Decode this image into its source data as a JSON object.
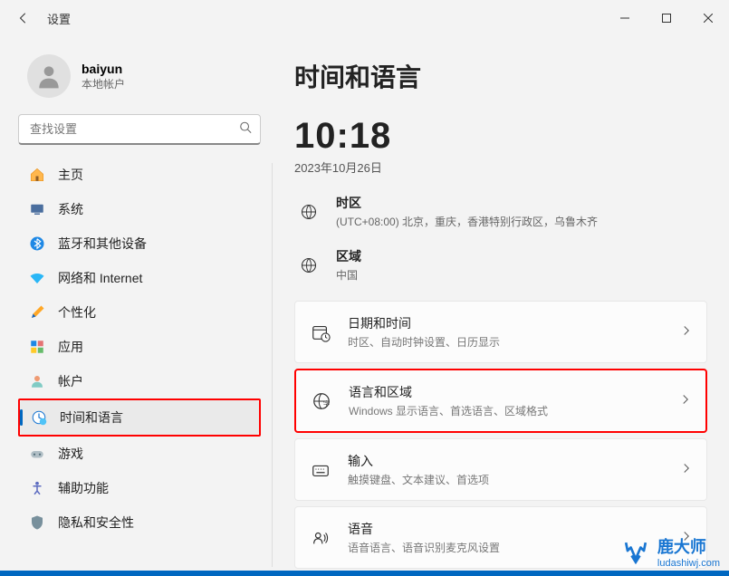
{
  "window": {
    "title": "设置"
  },
  "user": {
    "name": "baiyun",
    "type": "本地帐户"
  },
  "search": {
    "placeholder": "查找设置"
  },
  "nav": {
    "items": [
      {
        "label": "主页"
      },
      {
        "label": "系统"
      },
      {
        "label": "蓝牙和其他设备"
      },
      {
        "label": "网络和 Internet"
      },
      {
        "label": "个性化"
      },
      {
        "label": "应用"
      },
      {
        "label": "帐户"
      },
      {
        "label": "时间和语言"
      },
      {
        "label": "游戏"
      },
      {
        "label": "辅助功能"
      },
      {
        "label": "隐私和安全性"
      }
    ]
  },
  "page": {
    "title": "时间和语言",
    "time": "10:18",
    "date": "2023年10月26日",
    "timezone": {
      "label": "时区",
      "value": "(UTC+08:00) 北京，重庆，香港特别行政区，乌鲁木齐"
    },
    "region": {
      "label": "区域",
      "value": "中国"
    },
    "cards": [
      {
        "title": "日期和时间",
        "sub": "时区、自动时钟设置、日历显示"
      },
      {
        "title": "语言和区域",
        "sub": "Windows 显示语言、首选语言、区域格式"
      },
      {
        "title": "输入",
        "sub": "触摸键盘、文本建议、首选项"
      },
      {
        "title": "语音",
        "sub": "语音语言、语音识别麦克风设置"
      }
    ]
  },
  "watermark": {
    "name": "鹿大师",
    "url": "ludashiwj.com"
  }
}
